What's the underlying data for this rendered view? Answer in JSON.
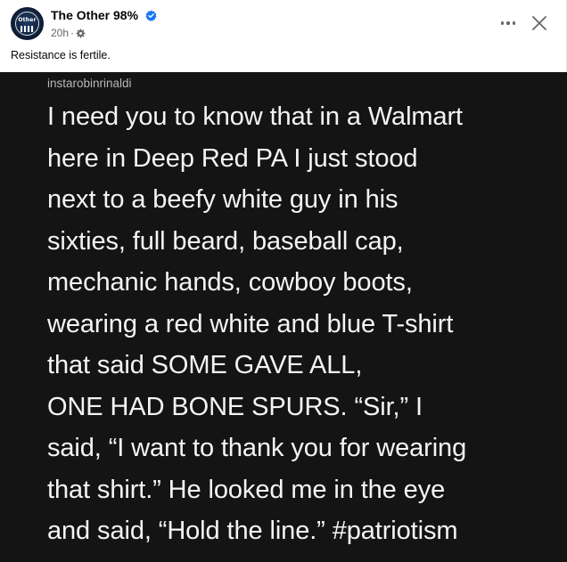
{
  "post": {
    "page_name": "The Other 98%",
    "timestamp": "20h",
    "separator": "·",
    "caption": "Resistance is fertile.",
    "icons": {
      "avatar": "the-other-98-logo",
      "verified": "verified-badge-icon",
      "audience": "public-gear-icon",
      "more": "more-options-icon",
      "close": "close-icon"
    },
    "accent_color": "#1877f2",
    "image": {
      "background": "#141414",
      "handle": "instarobinrinaldi",
      "lines": [
        "I need you to know that in a Walmart",
        "here in Deep Red PA I just stood",
        "next to a beefy white guy in his",
        "sixties, full beard, baseball cap,",
        "mechanic hands, cowboy boots,",
        "wearing a red white and blue T-shirt",
        "that said SOME GAVE ALL,",
        "ONE HAD BONE SPURS. “Sir,” I",
        "said, “I want to thank you for wearing",
        "that shirt.” He looked me in the eye",
        "and said, “Hold the line.” #patriotism"
      ]
    }
  }
}
